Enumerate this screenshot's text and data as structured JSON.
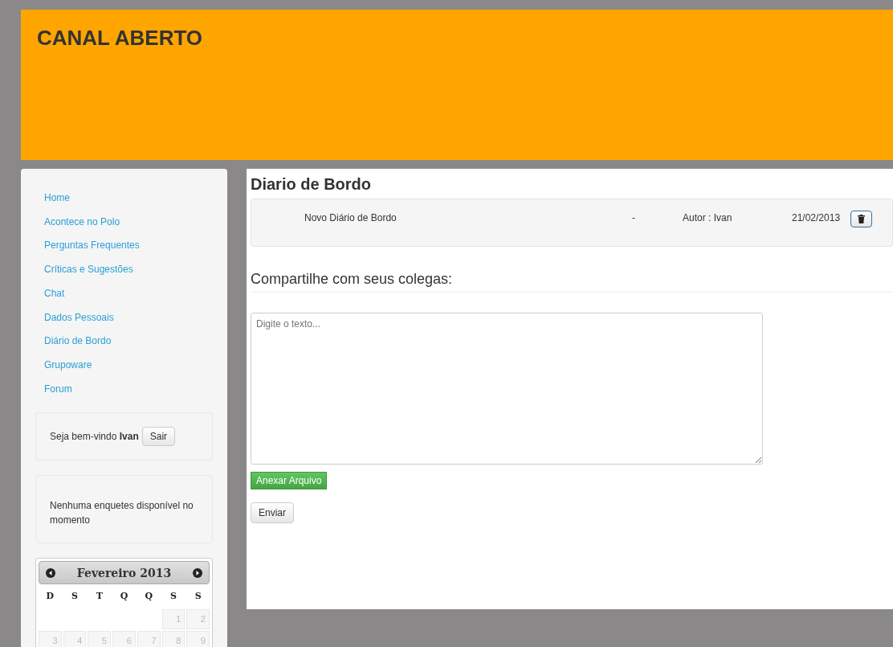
{
  "header": {
    "title": "CANAL ABERTO"
  },
  "sidebar": {
    "items": [
      {
        "label": "Home"
      },
      {
        "label": "Acontece no Polo"
      },
      {
        "label": "Perguntas Frequentes"
      },
      {
        "label": "Críticas e Sugestões"
      },
      {
        "label": "Chat"
      },
      {
        "label": "Dados Pessoais"
      },
      {
        "label": "Diário de Bordo"
      },
      {
        "label": "Grupoware"
      },
      {
        "label": "Forum"
      }
    ],
    "welcome": {
      "text": "Seja bem-vindo",
      "user": "Ivan",
      "button": "Sair"
    },
    "poll": {
      "text": "Nenhuma enquetes disponível no momento"
    },
    "calendar": {
      "month": "Fevereiro 2013",
      "weekdays": [
        "D",
        "S",
        "T",
        "Q",
        "Q",
        "S",
        "S"
      ],
      "weeks": [
        {
          "kind": "first",
          "days": [
            "1",
            "2"
          ]
        },
        {
          "kind": "full",
          "days": [
            "3",
            "4",
            "5",
            "6",
            "7",
            "8",
            "9"
          ]
        }
      ]
    }
  },
  "main": {
    "title": "Diario de Bordo",
    "entries": [
      {
        "title": "Novo Diário de Bordo",
        "separator": "-",
        "author": "Autor : Ivan",
        "date": "21/02/2013"
      }
    ],
    "share_heading": "Compartilhe com seus colegas:",
    "textarea": {
      "placeholder": "Digite o texto..."
    },
    "attach_button": "Anexar Arquivo",
    "send_button": "Enviar"
  }
}
